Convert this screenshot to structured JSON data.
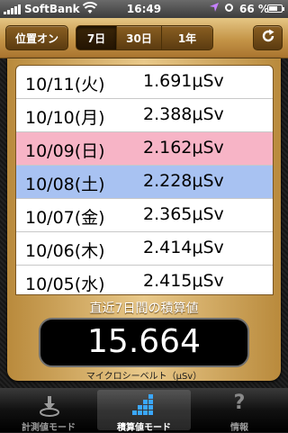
{
  "status_bar": {
    "carrier": "SoftBank",
    "time": "16:49",
    "battery_percent": "66 %",
    "battery_level": 0.66
  },
  "toolbar": {
    "position_on_label": "位置オン",
    "range_tabs": [
      {
        "label": "7日",
        "selected": true
      },
      {
        "label": "30日",
        "selected": false
      },
      {
        "label": "1年",
        "selected": false
      }
    ],
    "refresh_icon": "refresh-icon"
  },
  "readings": [
    {
      "date": "10/11(火)",
      "value": "1.691μSv",
      "highlight": "none"
    },
    {
      "date": "10/10(月)",
      "value": "2.388μSv",
      "highlight": "none"
    },
    {
      "date": "10/09(日)",
      "value": "2.162μSv",
      "highlight": "sunday"
    },
    {
      "date": "10/08(土)",
      "value": "2.228μSv",
      "highlight": "saturday"
    },
    {
      "date": "10/07(金)",
      "value": "2.365μSv",
      "highlight": "none"
    },
    {
      "date": "10/06(木)",
      "value": "2.414μSv",
      "highlight": "none"
    },
    {
      "date": "10/05(水)",
      "value": "2.415μSv",
      "highlight": "none"
    }
  ],
  "summary": {
    "label": "直近7日間の積算値",
    "value": "15.664",
    "unit": "マイクロシーベルト（μSv）"
  },
  "colors": {
    "sunday_row": "#f7b4c6",
    "saturday_row": "#a8c2f2",
    "gold": "#c49447",
    "tab_icon_active": "#3aa7ff"
  },
  "tabbar": {
    "tabs": [
      {
        "label": "計測値モード",
        "icon": "measure-icon",
        "active": false
      },
      {
        "label": "積算値モード",
        "icon": "grid-icon",
        "active": true
      },
      {
        "label": "情報",
        "icon": "info-icon",
        "active": false
      }
    ]
  }
}
